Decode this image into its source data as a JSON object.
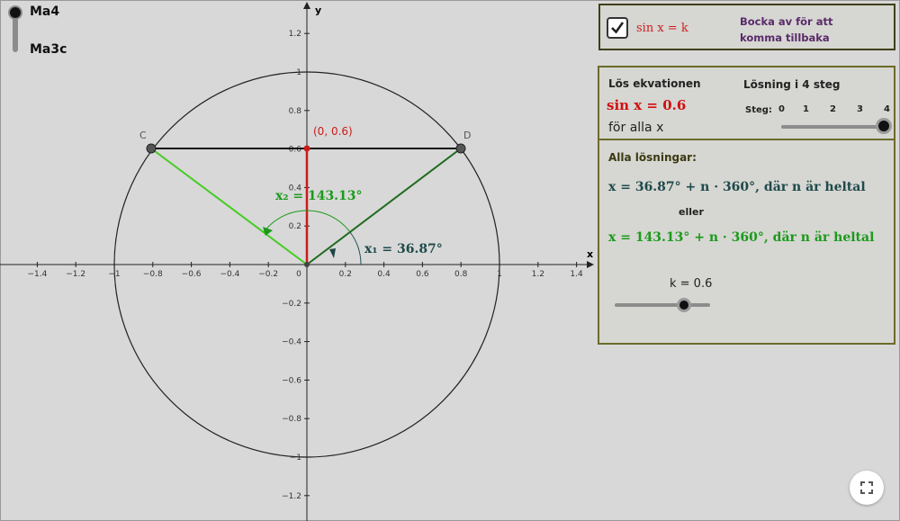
{
  "course_toggle": {
    "top_label": "Ma4",
    "bottom_label": "Ma3c",
    "selected": "Ma4"
  },
  "graph": {
    "axis_labels": {
      "x": "x",
      "y": "y"
    },
    "x_ticks": [
      "−1.4",
      "−1.2",
      "−1",
      "−0.8",
      "−0.6",
      "−0.4",
      "−0.2",
      "0",
      "0.2",
      "0.4",
      "0.6",
      "0.8",
      "1",
      "1.2",
      "1.4"
    ],
    "y_ticks": [
      "1.2",
      "1",
      "0.8",
      "0.6",
      "0.4",
      "0.2",
      "−0.2",
      "−0.4",
      "−0.6",
      "−0.8",
      "−1",
      "−1.2"
    ],
    "point_c": "C",
    "point_d": "D",
    "point_label": "(0, 0.6)",
    "angle_x1": "x₁ = 36.87°",
    "angle_x2": "x₂ = 143.13°",
    "colors": {
      "red": "#cc1a1a",
      "dark_green": "#1f6b1f",
      "light_green": "#44cc22",
      "circle": "#222222"
    }
  },
  "toggle": {
    "checked": true,
    "label": "sin x = k",
    "hint_line1": "Bocka av för att",
    "hint_line2": "komma tillbaka"
  },
  "solve": {
    "title": "Lös ekvationen",
    "equation": "sin x = 0.6",
    "for_all": "för alla x",
    "steps_title": "Lösning i 4 steg",
    "steps_label": "Steg:",
    "step_values": [
      "0",
      "1",
      "2",
      "3",
      "4"
    ],
    "current_step": 4
  },
  "solutions": {
    "title": "Alla lösningar:",
    "sol1": "x = 36.87° + n · 360°,  där n är heltal",
    "or": "eller",
    "sol2": "x = 143.13° + n · 360°,  där n är heltal"
  },
  "k_slider": {
    "label": "k = 0.6",
    "value": 0.6
  },
  "fullscreen_icon": "fullscreen-icon"
}
